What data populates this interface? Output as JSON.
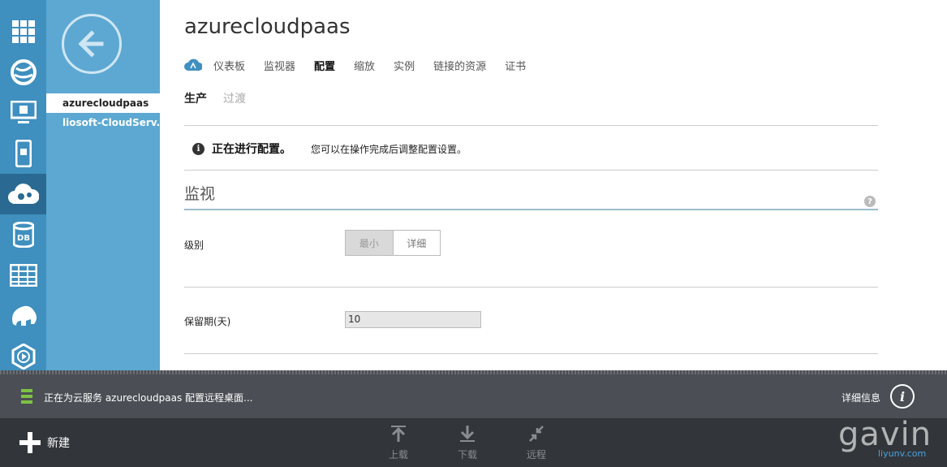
{
  "service_list": {
    "items": [
      {
        "label": "azurecloudpaas",
        "selected": true
      },
      {
        "label": "liosoft-CloudServ..."
      }
    ]
  },
  "rail": {
    "icons": [
      "all-items-icon",
      "websites-icon",
      "virtual-machines-icon",
      "mobile-services-icon",
      "cloud-services-icon",
      "sql-databases-icon",
      "storage-icon",
      "hdinsight-icon",
      "media-services-icon"
    ],
    "active": "cloud-services-icon"
  },
  "page": {
    "title": "azurecloudpaas",
    "tabs": [
      "仪表板",
      "监视器",
      "配置",
      "缩放",
      "实例",
      "链接的资源",
      "证书"
    ],
    "active_tab": "配置",
    "env_tabs": [
      "生产",
      "过渡"
    ],
    "active_env": "生产"
  },
  "notice": {
    "title": "正在进行配置。",
    "text": "您可以在操作完成后调整配置设置。"
  },
  "monitoring": {
    "section_title": "监视",
    "level_label": "级别",
    "level_options": [
      "最小",
      "详细"
    ],
    "level_selected": "最小",
    "retention_label": "保留期(天)",
    "retention_value": "10"
  },
  "notification": {
    "text": "正在为云服务 azurecloudpaas 配置远程桌面...",
    "details_label": "详细信息"
  },
  "command_bar": {
    "new_label": "新建",
    "upload_label": "上载",
    "download_label": "下载",
    "remote_label": "远程"
  },
  "watermark": {
    "text": "gavin",
    "site": "liyunv.com"
  },
  "colors": {
    "rail": "#3f8fbf",
    "service_panel": "#5ca8d2",
    "notification_bar": "#4b4f55",
    "command_bar": "#32363b",
    "progress": "#7cc243"
  }
}
